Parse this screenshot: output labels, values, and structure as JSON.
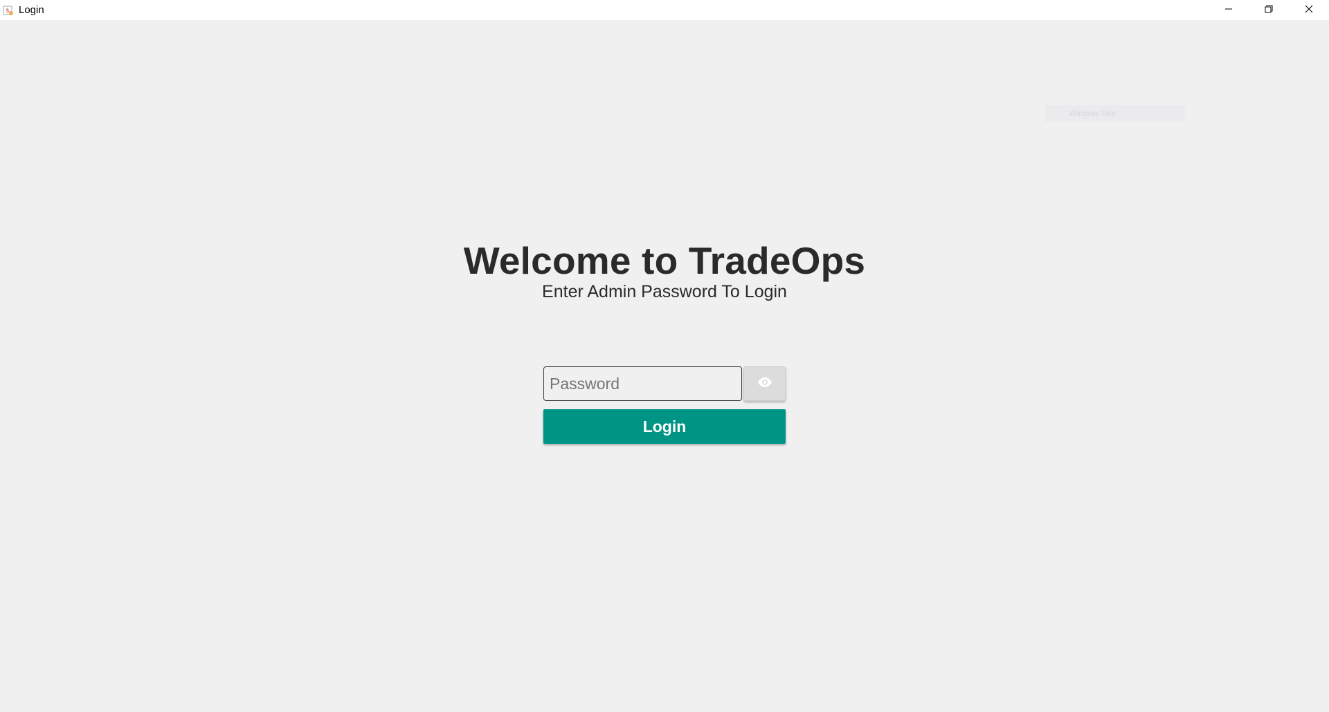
{
  "window": {
    "title": "Login",
    "app_icon": "app-logo-icon",
    "controls": {
      "minimize_icon": "minimize-icon",
      "restore_icon": "restore-icon",
      "close_icon": "close-icon"
    }
  },
  "faint_overlay": {
    "text": "Window Title"
  },
  "main": {
    "heading": "Welcome to TradeOps",
    "subheading": "Enter Admin Password To Login",
    "password_field": {
      "placeholder": "Password",
      "value": ""
    },
    "toggle_visibility_icon": "eye-icon",
    "login_button_label": "Login"
  },
  "colors": {
    "background": "#f0f0f0",
    "titlebar": "#ffffff",
    "heading_text": "#2a2a2a",
    "login_button": "#009485",
    "login_text": "#ffffff",
    "eye_button": "#dcdcdc"
  }
}
